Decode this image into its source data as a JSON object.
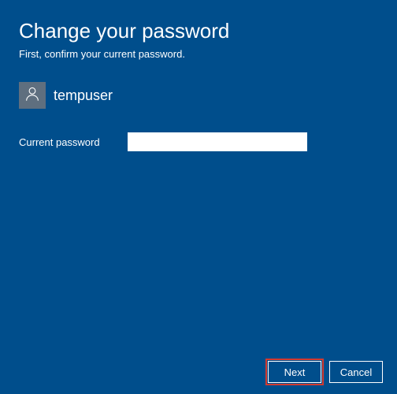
{
  "title": "Change your password",
  "subtitle": "First, confirm your current password.",
  "user": {
    "name": "tempuser"
  },
  "field": {
    "label": "Current password",
    "value": ""
  },
  "buttons": {
    "next": "Next",
    "cancel": "Cancel"
  }
}
